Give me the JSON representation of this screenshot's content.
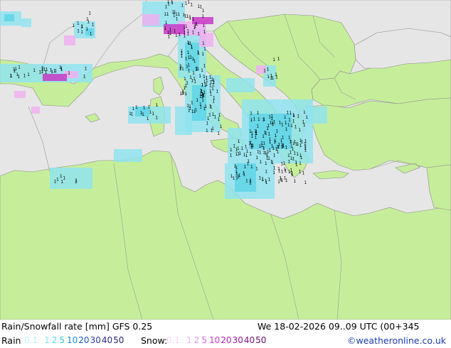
{
  "header": {
    "title": "Rain/Snowfall rate [mm] GFS 0.25",
    "datetime": "We 18-02-2026 09..09 UTC (00+345"
  },
  "legend": {
    "rain_label": "Rain",
    "rain_values": [
      {
        "text": "0.1",
        "color": "#bfeff5"
      },
      {
        "text": "1",
        "color": "#8fe3ee"
      },
      {
        "text": "2",
        "color": "#5fd5e6"
      },
      {
        "text": "5",
        "color": "#2fc3dc"
      },
      {
        "text": "10",
        "color": "#1a8ad2"
      },
      {
        "text": "20",
        "color": "#1a5abe"
      },
      {
        "text": "30",
        "color": "#2a3aa2"
      },
      {
        "text": "40",
        "color": "#2a2a8a"
      },
      {
        "text": "50",
        "color": "#1a1a6a"
      }
    ],
    "snow_label": "Snow:",
    "snow_values": [
      {
        "text": "0.1",
        "color": "#f8d8f8"
      },
      {
        "text": "1",
        "color": "#f0b0f0"
      },
      {
        "text": "2",
        "color": "#e690e6"
      },
      {
        "text": "5",
        "color": "#d860d8"
      },
      {
        "text": "10",
        "color": "#c838c8"
      },
      {
        "text": "20",
        "color": "#b020b0"
      },
      {
        "text": "30",
        "color": "#981898"
      },
      {
        "text": "40",
        "color": "#801080"
      },
      {
        "text": "50",
        "color": "#680868"
      }
    ],
    "credit": "©weatheronline.co.uk",
    "credit_color": "#1a3ab4"
  },
  "map": {
    "land_color": "#c6ee9a",
    "sea_color": "#e6e6e6",
    "border_color": "#9a9a9a",
    "precip_marker_char": "1"
  }
}
